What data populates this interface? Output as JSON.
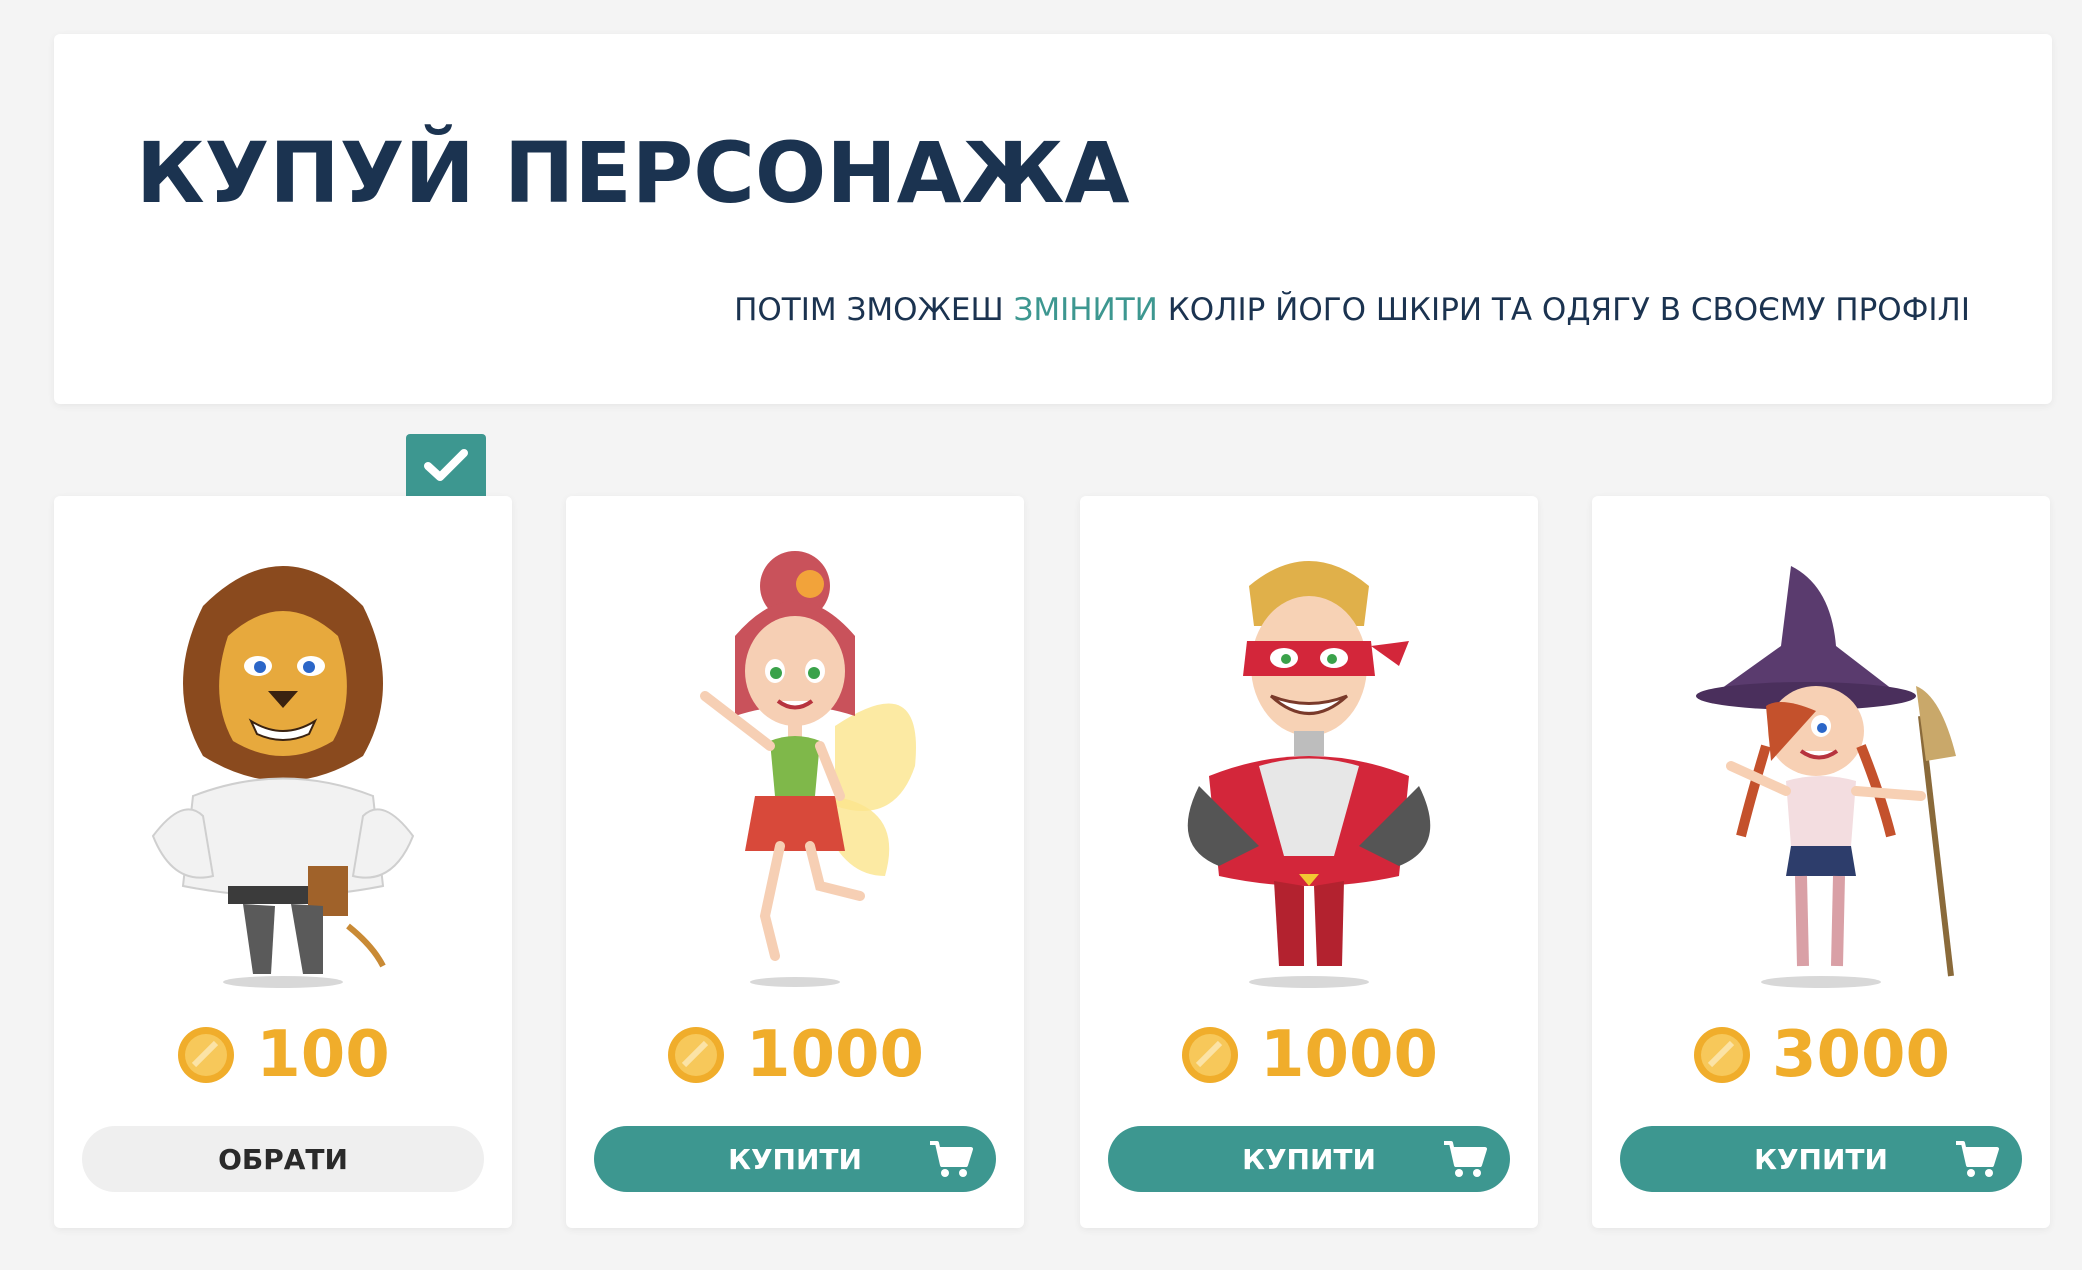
{
  "header": {
    "title": "КУПУЙ ПЕРСОНАЖА",
    "subtitle_before": "ПОТІМ ЗМОЖЕШ ",
    "subtitle_link": "ЗМІНИТИ",
    "subtitle_after": " КОЛІР ЙОГО ШКІРИ ТА ОДЯГУ В СВОЄМУ ПРОФІЛІ"
  },
  "colors": {
    "title": "#1b3350",
    "accent": "#3d9790",
    "price": "#f0ad2b",
    "select_button": "#efefef"
  },
  "characters": [
    {
      "character": "lion",
      "price": "100",
      "button": "ОБРАТИ",
      "selected": true
    },
    {
      "character": "fairy",
      "price": "1000",
      "button": "КУПИТИ",
      "selected": false
    },
    {
      "character": "superhero",
      "price": "1000",
      "button": "КУПИТИ",
      "selected": false
    },
    {
      "character": "witch",
      "price": "3000",
      "button": "КУПИТИ",
      "selected": false
    }
  ],
  "icons": {
    "selected": "check-icon",
    "coin": "coin-icon",
    "buy": "cart-icon"
  }
}
